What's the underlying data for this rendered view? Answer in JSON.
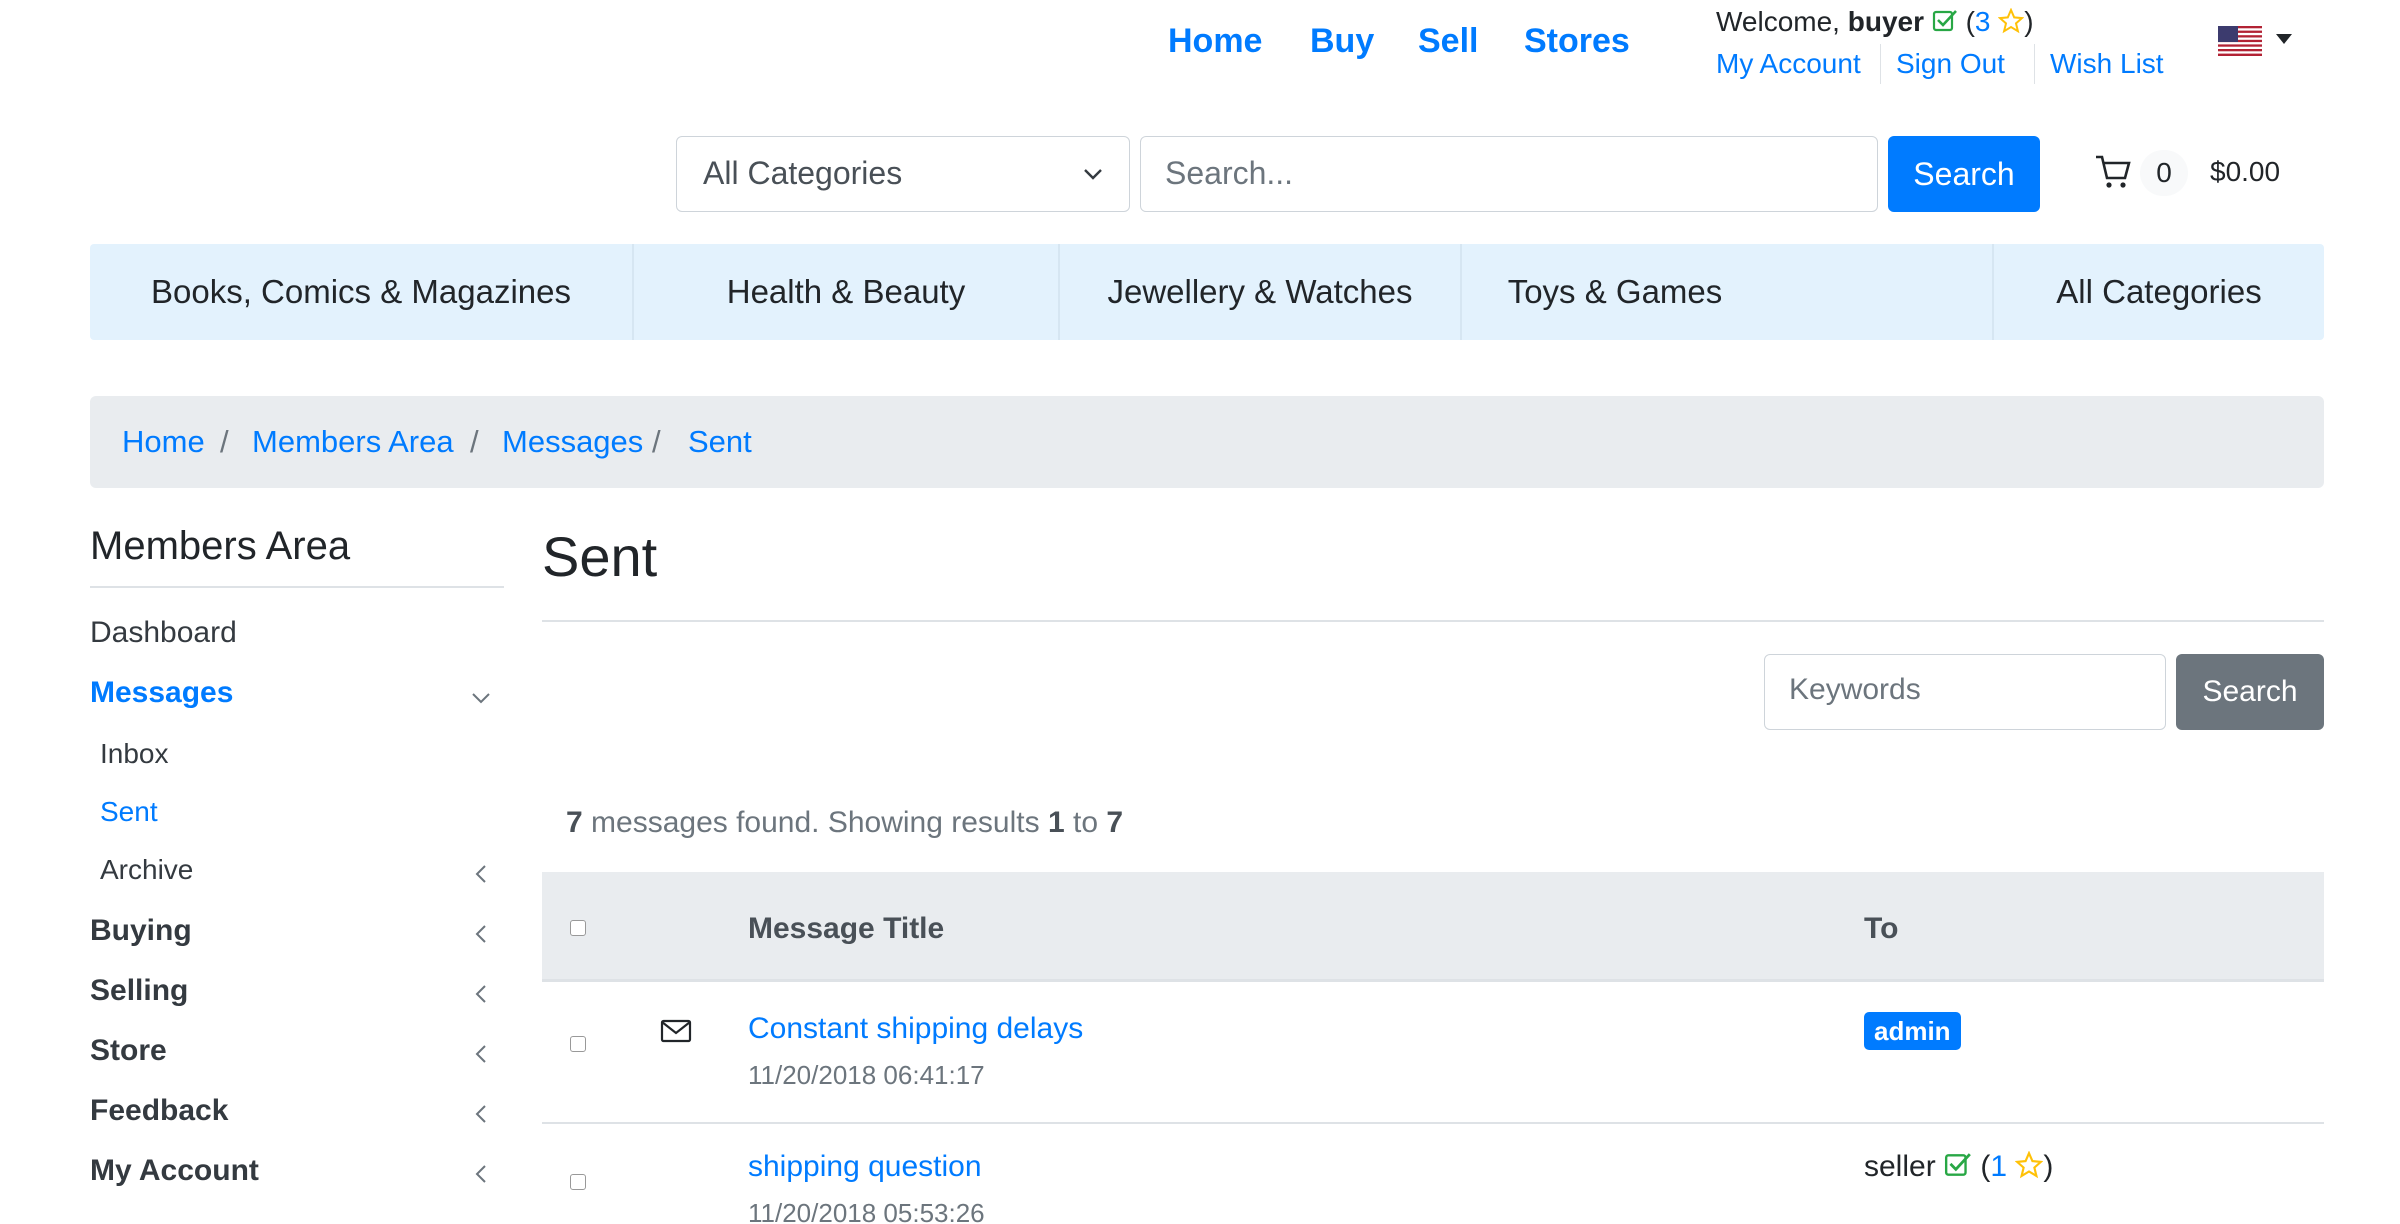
{
  "topnav": {
    "links": [
      "Home",
      "Buy",
      "Sell",
      "Stores"
    ],
    "welcome_prefix": "Welcome,",
    "username": "buyer",
    "rating_open": "(",
    "rating_count": "3",
    "rating_close": ")",
    "account_links": [
      "My Account",
      "Sign Out",
      "Wish List"
    ]
  },
  "search": {
    "category_value": "All Categories",
    "placeholder": "Search...",
    "button_label": "Search"
  },
  "cart": {
    "count": "0",
    "total": "$0.00"
  },
  "categories": [
    "Books, Comics & Magazines",
    "Health & Beauty",
    "Jewellery & Watches",
    "Toys & Games",
    "All Categories"
  ],
  "breadcrumb": [
    "Home",
    "Members Area",
    "Messages",
    "Sent"
  ],
  "sidebar": {
    "title": "Members Area",
    "dashboard": "Dashboard",
    "messages": "Messages",
    "sub_items": [
      "Inbox",
      "Sent",
      "Archive"
    ],
    "sections": [
      "Buying",
      "Selling",
      "Store",
      "Feedback",
      "My Account"
    ]
  },
  "main": {
    "title": "Sent",
    "keywords_placeholder": "Keywords",
    "search_label": "Search",
    "results": {
      "count": "7",
      "text1": "messages found. Showing results",
      "from": "1",
      "to_word": "to",
      "to": "7"
    },
    "columns": [
      "Message Title",
      "To"
    ],
    "rows": [
      {
        "title": "Constant shipping delays",
        "date": "11/20/2018 06:41:17",
        "to": "admin"
      },
      {
        "title": "shipping question",
        "date": "11/20/2018 05:53:26",
        "to": "seller",
        "rating": "1"
      }
    ]
  },
  "colors": {
    "primary": "#007bff",
    "secondary": "#6c757d",
    "success": "#28a745",
    "star": "#ffc107",
    "catbar": "#e3f2fd",
    "breadcrumb_bg": "#e9ecef"
  }
}
